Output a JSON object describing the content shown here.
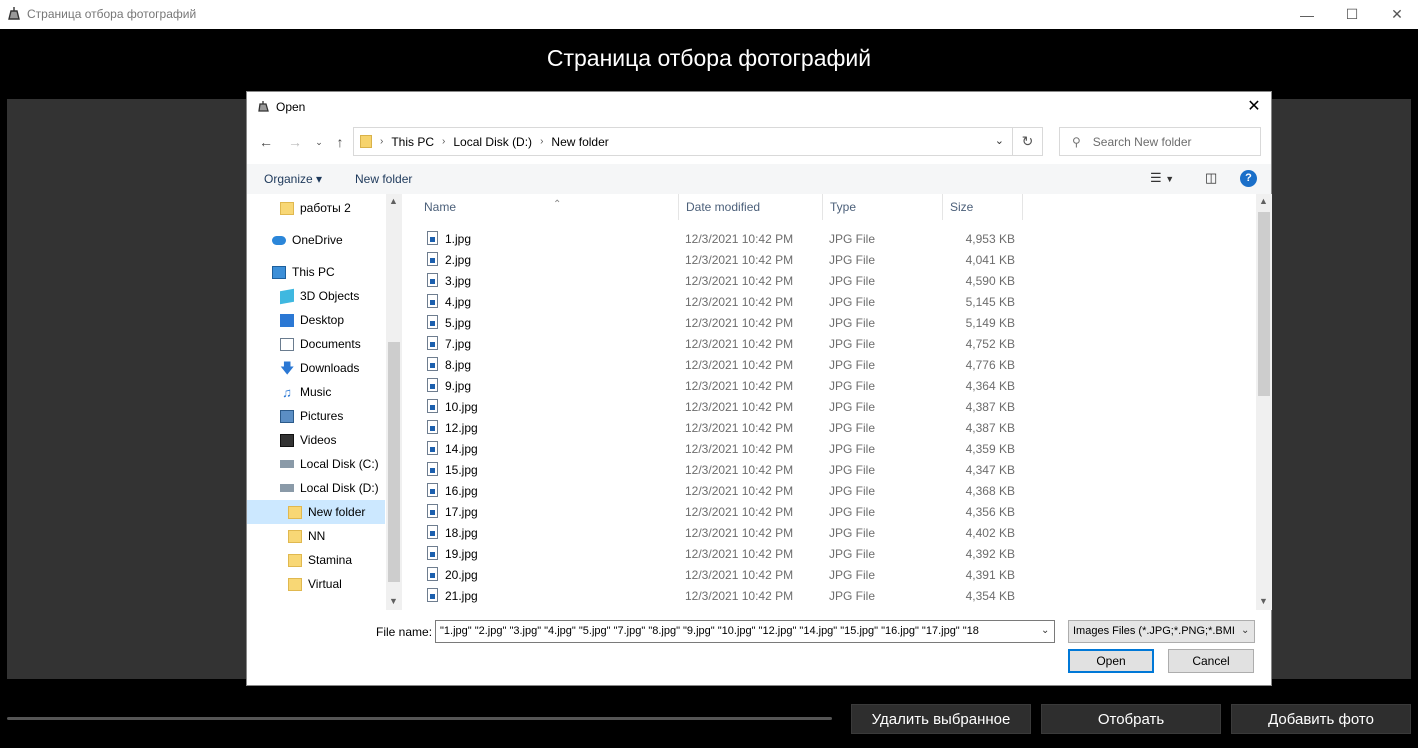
{
  "window": {
    "title": "Страница отбора фотографий",
    "heading": "Страница отбора фотографий"
  },
  "bottom_buttons": {
    "delete": "Удалить выбранное",
    "select": "Отобрать",
    "add": "Добавить фото"
  },
  "dialog": {
    "title": "Open",
    "breadcrumb": [
      "This PC",
      "Local Disk (D:)",
      "New folder"
    ],
    "search_placeholder": "Search New folder",
    "organize": "Organize ▾",
    "new_folder": "New folder",
    "nav_items": [
      {
        "label": "работы 2",
        "icon": "folder-icon"
      },
      {
        "label": "OneDrive",
        "icon": "onedrive-icon"
      },
      {
        "label": "This PC",
        "icon": "this-pc-icon"
      },
      {
        "label": "3D Objects",
        "icon": "3d-objects-icon"
      },
      {
        "label": "Desktop",
        "icon": "desktop-icon"
      },
      {
        "label": "Documents",
        "icon": "documents-icon"
      },
      {
        "label": "Downloads",
        "icon": "downloads-icon"
      },
      {
        "label": "Music",
        "icon": "music-icon"
      },
      {
        "label": "Pictures",
        "icon": "pictures-icon"
      },
      {
        "label": "Videos",
        "icon": "videos-icon"
      },
      {
        "label": "Local Disk (C:)",
        "icon": "drive-icon"
      },
      {
        "label": "Local Disk (D:)",
        "icon": "drive-icon"
      },
      {
        "label": "New folder",
        "icon": "folder-icon"
      },
      {
        "label": "NN",
        "icon": "folder-icon"
      },
      {
        "label": "Stamina",
        "icon": "folder-icon"
      },
      {
        "label": "Virtual",
        "icon": "folder-icon"
      }
    ],
    "columns": {
      "name": "Name",
      "date": "Date modified",
      "type": "Type",
      "size": "Size"
    },
    "files": [
      {
        "name": "1.jpg",
        "date": "12/3/2021 10:42 PM",
        "type": "JPG File",
        "size": "4,953 KB"
      },
      {
        "name": "2.jpg",
        "date": "12/3/2021 10:42 PM",
        "type": "JPG File",
        "size": "4,041 KB"
      },
      {
        "name": "3.jpg",
        "date": "12/3/2021 10:42 PM",
        "type": "JPG File",
        "size": "4,590 KB"
      },
      {
        "name": "4.jpg",
        "date": "12/3/2021 10:42 PM",
        "type": "JPG File",
        "size": "5,145 KB"
      },
      {
        "name": "5.jpg",
        "date": "12/3/2021 10:42 PM",
        "type": "JPG File",
        "size": "5,149 KB"
      },
      {
        "name": "7.jpg",
        "date": "12/3/2021 10:42 PM",
        "type": "JPG File",
        "size": "4,752 KB"
      },
      {
        "name": "8.jpg",
        "date": "12/3/2021 10:42 PM",
        "type": "JPG File",
        "size": "4,776 KB"
      },
      {
        "name": "9.jpg",
        "date": "12/3/2021 10:42 PM",
        "type": "JPG File",
        "size": "4,364 KB"
      },
      {
        "name": "10.jpg",
        "date": "12/3/2021 10:42 PM",
        "type": "JPG File",
        "size": "4,387 KB"
      },
      {
        "name": "12.jpg",
        "date": "12/3/2021 10:42 PM",
        "type": "JPG File",
        "size": "4,387 KB"
      },
      {
        "name": "14.jpg",
        "date": "12/3/2021 10:42 PM",
        "type": "JPG File",
        "size": "4,359 KB"
      },
      {
        "name": "15.jpg",
        "date": "12/3/2021 10:42 PM",
        "type": "JPG File",
        "size": "4,347 KB"
      },
      {
        "name": "16.jpg",
        "date": "12/3/2021 10:42 PM",
        "type": "JPG File",
        "size": "4,368 KB"
      },
      {
        "name": "17.jpg",
        "date": "12/3/2021 10:42 PM",
        "type": "JPG File",
        "size": "4,356 KB"
      },
      {
        "name": "18.jpg",
        "date": "12/3/2021 10:42 PM",
        "type": "JPG File",
        "size": "4,402 KB"
      },
      {
        "name": "19.jpg",
        "date": "12/3/2021 10:42 PM",
        "type": "JPG File",
        "size": "4,392 KB"
      },
      {
        "name": "20.jpg",
        "date": "12/3/2021 10:42 PM",
        "type": "JPG File",
        "size": "4,391 KB"
      },
      {
        "name": "21.jpg",
        "date": "12/3/2021 10:42 PM",
        "type": "JPG File",
        "size": "4,354 KB"
      }
    ],
    "file_name_label": "File name:",
    "file_name_value": "\"1.jpg\" \"2.jpg\" \"3.jpg\" \"4.jpg\" \"5.jpg\" \"7.jpg\" \"8.jpg\" \"9.jpg\" \"10.jpg\" \"12.jpg\" \"14.jpg\" \"15.jpg\" \"16.jpg\" \"17.jpg\" \"18",
    "file_type": "Images Files (*.JPG;*.PNG;*.BMI",
    "open": "Open",
    "cancel": "Cancel"
  },
  "colors": {
    "accent": "#0078d7",
    "selected_bg": "#cce8ff",
    "folder": "#f8d775"
  }
}
